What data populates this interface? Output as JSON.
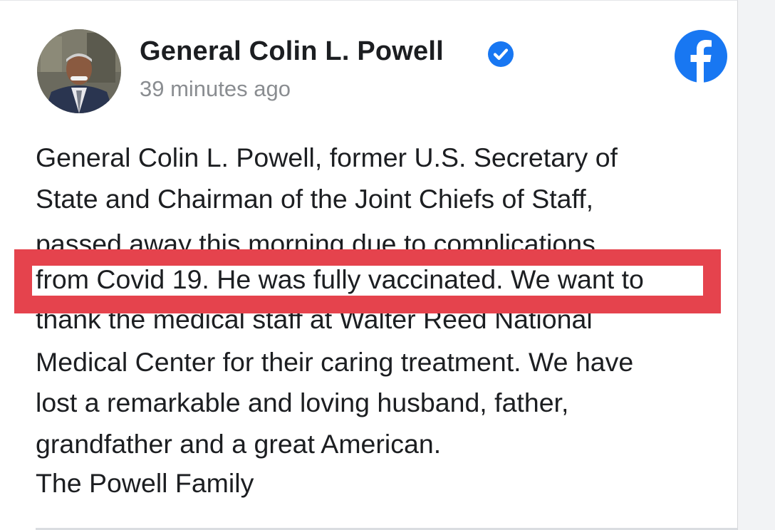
{
  "post": {
    "author": "General Colin L. Powell",
    "timestamp": "39 minutes ago",
    "verified": true,
    "lines": [
      "General Colin L. Powell, former U.S. Secretary of",
      "State and Chairman of the Joint Chiefs of Staff,",
      "passed away this morning due to complications",
      "from Covid 19. He was fully vaccinated. We want to",
      "thank the medical staff at Walter Reed National",
      "Medical Center for their caring treatment. We have",
      "lost a remarkable and loving husband, father,",
      "grandfather and a great American.",
      "The Powell Family"
    ]
  },
  "icons": {
    "avatar": "profile-photo",
    "verified": "verified-badge-icon",
    "platform": "facebook-logo-icon"
  },
  "colors": {
    "highlight": "#e5434d",
    "facebook_blue": "#1877f2",
    "text": "#1c1e21",
    "muted": "#8a8d91"
  }
}
